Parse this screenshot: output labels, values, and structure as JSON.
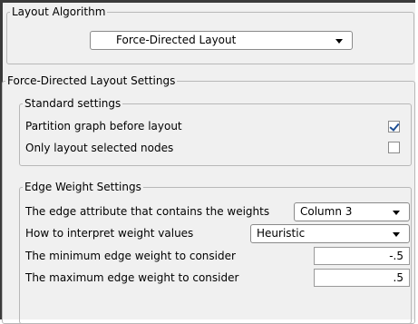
{
  "layout_algorithm": {
    "legend": "Layout Algorithm",
    "selected": "Force-Directed Layout"
  },
  "fd_settings": {
    "legend": "Force-Directed Layout Settings",
    "standard": {
      "legend": "Standard settings",
      "partition_label": "Partition graph before layout",
      "partition_checked": true,
      "selected_only_label": "Only layout selected nodes",
      "selected_only_checked": false
    },
    "edge_weight": {
      "legend": "Edge Weight Settings",
      "attribute_label": "The edge attribute that contains the weights",
      "attribute_value": "Column 3",
      "interpret_label": "How to interpret weight values",
      "interpret_value": "Heuristic",
      "min_label": "The minimum edge weight to consider",
      "min_value": "-.5",
      "max_label": "The maximum edge weight to consider",
      "max_value": ".5"
    }
  }
}
